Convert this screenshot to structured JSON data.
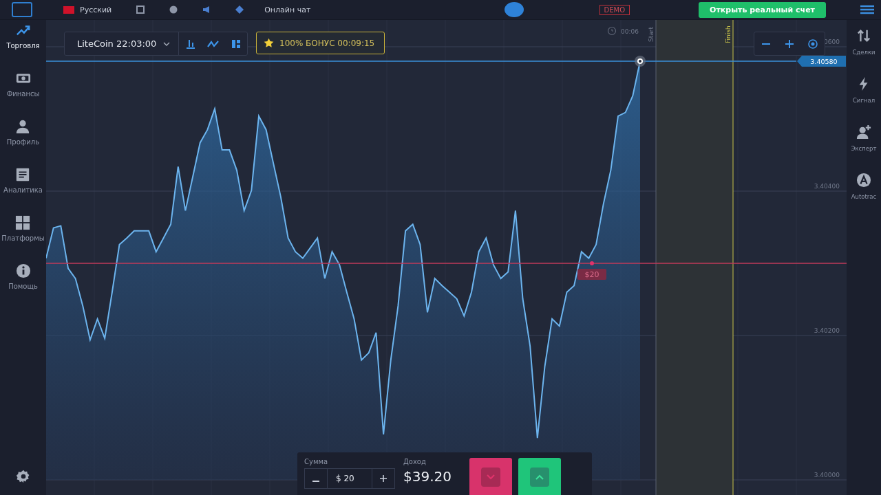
{
  "top_bar": {
    "language": "Русский",
    "chat": "Онлайн чат",
    "account_badge": "DEMO",
    "real_account_button": "Открыть реальный счет"
  },
  "sidebar": {
    "items": [
      {
        "label": "Торговля",
        "kind": "trend",
        "selected": true
      },
      {
        "label": "Финансы",
        "kind": "money",
        "selected": false
      },
      {
        "label": "Профиль",
        "kind": "person",
        "selected": false
      },
      {
        "label": "Аналитика",
        "kind": "doc",
        "selected": false
      },
      {
        "label": "Платформы",
        "kind": "grid",
        "selected": false
      },
      {
        "label": "Помощь",
        "kind": "info",
        "selected": false
      }
    ]
  },
  "toolbar": {
    "asset": "LiteCoin 22:03:00",
    "bonus": "100% БОНУС 00:09:15"
  },
  "chart": {
    "timer": "00:06",
    "start_label": "Start",
    "finish_label": "Finish",
    "current_price_tag": "3.40580",
    "strike_label": "$20",
    "partial_axis_label": "0600",
    "chart_data": {
      "type": "area",
      "grid": true,
      "ylim": [
        3.4,
        3.406
      ],
      "yticks": [
        {
          "value": 3.404,
          "label": "3.40400"
        },
        {
          "value": 3.402,
          "label": "3.40200"
        },
        {
          "value": 3.4,
          "label": "3.40000"
        }
      ],
      "ref_lines": [
        {
          "axis": "y",
          "value": 3.403,
          "color": "#c13a5a"
        },
        {
          "axis": "y",
          "value": 3.4058,
          "color": "#3a8fd8"
        }
      ],
      "series": [
        {
          "color": "#6cb4ee",
          "values": [
            3.40307,
            3.40349,
            3.40352,
            3.40293,
            3.40279,
            3.40241,
            3.40194,
            3.40223,
            3.40196,
            3.4026,
            3.40326,
            3.40335,
            3.40345,
            3.40345,
            3.40345,
            3.40316,
            3.40335,
            3.40354,
            3.40434,
            3.40373,
            3.4042,
            3.40467,
            3.40485,
            3.40514,
            3.40457,
            3.40457,
            3.40429,
            3.40373,
            3.40401,
            3.40504,
            3.40485,
            3.40438,
            3.40392,
            3.40335,
            3.40316,
            3.40307,
            3.40321,
            3.40335,
            3.40279,
            3.40316,
            3.40298,
            3.4026,
            3.40223,
            3.40166,
            3.40176,
            3.40204,
            3.40063,
            3.40166,
            3.40241,
            3.40345,
            3.40354,
            3.40326,
            3.40232,
            3.40279,
            3.40269,
            3.4026,
            3.40251,
            3.40227,
            3.4026,
            3.40316,
            3.40335,
            3.40298,
            3.40279,
            3.40288,
            3.40373,
            3.40251,
            3.40185,
            3.40058,
            3.40157,
            3.40223,
            3.40213,
            3.4026,
            3.40269,
            3.40316,
            3.40307,
            3.40326,
            3.40382,
            3.40429,
            3.40504,
            3.40509,
            3.40532,
            3.4058
          ]
        }
      ]
    }
  },
  "trade_panel": {
    "amount_label": "Сумма",
    "amount": "$ 20",
    "income_label": "Доход",
    "income": "$39.20"
  },
  "right_sidebar": {
    "items": [
      {
        "label": "Сделки",
        "kind": "swap"
      },
      {
        "label": "Сигнал",
        "kind": "bolt"
      },
      {
        "label": "Эксперт",
        "kind": "person-plus"
      },
      {
        "label": "Autotrac",
        "kind": "letter-a"
      }
    ]
  }
}
